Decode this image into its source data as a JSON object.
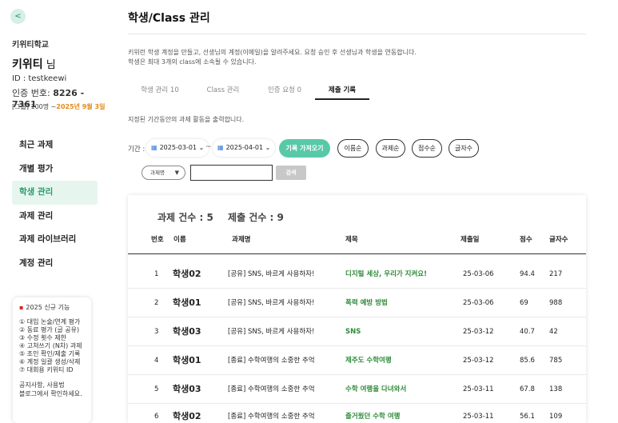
{
  "sidebar": {
    "collapse_symbol": "<",
    "school": "키위티학교",
    "user_name": "키위티",
    "user_suffix": " 님",
    "user_id": "ID : testkeewi",
    "auth_label": "인증 번호: ",
    "auth_code": "8226 - 7361",
    "group_prefix": "[그룹] 100명 ~",
    "group_date": "2025년 9월 3일",
    "nav": [
      {
        "label": "최근 과제",
        "active": false
      },
      {
        "label": "개별 평가",
        "active": false
      },
      {
        "label": "학생 관리",
        "active": true
      },
      {
        "label": "과제 관리",
        "active": false
      },
      {
        "label": "과제 라이브러리",
        "active": false
      },
      {
        "label": "계정 관리",
        "active": false
      }
    ],
    "notice": {
      "title": "2025 신규 기능",
      "flag_icon": "flag-icon",
      "features": [
        "① 대입 논술/연계 평가",
        "② 동료 평가 (글 공유)",
        "③ 수정 횟수 제한",
        "④ 고쳐쓰기 (N차) 과제",
        "⑤ 조인 확인/제출 기록",
        "⑥ 계정 일괄 생성/삭제",
        "⑦ 대회용 키위티 ID"
      ],
      "footer_line1": "공지사항, 사용법",
      "footer_line2": "블로그에서 확인하세요."
    }
  },
  "main": {
    "title": "학생/Class 관리",
    "desc_line1": "키위런 학생 계정을 만들고, 선생님의 계정(이메일)을 알려주세요. 요청 승인 후 선생님과 학생을 연동합니다.",
    "desc_line2": "학생은 최대 3개의 class에 소속될 수 있습니다.",
    "tabs": [
      {
        "label": "학생 관리  10",
        "active": false
      },
      {
        "label": "Class 관리",
        "active": false
      },
      {
        "label": "인증 요청  0",
        "active": false
      },
      {
        "label": "제출 기록",
        "active": true
      }
    ],
    "period_note": "지정된 기간동안의 과제 활동을 출력합니다.",
    "filter_label": "기간 :",
    "start_date": "2025-03-01",
    "end_date": "2025-04-01",
    "tilde": "~",
    "fetch_label": "기록 가져오기",
    "sort_buttons": [
      "이름순",
      "과제순",
      "점수순",
      "글자수"
    ],
    "search_select": "과제명",
    "search_value": "",
    "search_button": "검색",
    "count_task": "과제 건수 : 5",
    "count_submit": "제출 건수 : 9",
    "table": {
      "headers": [
        "번호",
        "이름",
        "과제명",
        "제목",
        "제출일",
        "점수",
        "글자수"
      ],
      "rows": [
        {
          "no": "1",
          "name": "학생02",
          "task": "[공유] SNS, 바르게 사용하자!",
          "title": "디지털 세상, 우리가 지켜요!",
          "date": "25-03-06",
          "score": "94.4",
          "chars": "217"
        },
        {
          "no": "2",
          "name": "학생01",
          "task": "[공유] SNS, 바르게 사용하자!",
          "title": "폭력 예방 방법",
          "date": "25-03-06",
          "score": "69",
          "chars": "988"
        },
        {
          "no": "3",
          "name": "학생03",
          "task": "[공유] SNS, 바르게 사용하자!",
          "title": "SNS",
          "date": "25-03-12",
          "score": "40.7",
          "chars": "42"
        },
        {
          "no": "4",
          "name": "학생01",
          "task": "[종료] 수학여행의 소중한 추억",
          "title": "제주도 수학여행",
          "date": "25-03-12",
          "score": "85.6",
          "chars": "785"
        },
        {
          "no": "5",
          "name": "학생03",
          "task": "[종료] 수학여행의 소중한 추억",
          "title": "수학 여행을 다녀와서",
          "date": "25-03-11",
          "score": "67.8",
          "chars": "138"
        },
        {
          "no": "6",
          "name": "학생02",
          "task": "[종료] 수학여행의 소중한 추억",
          "title": "즐거웠던 수학 여행",
          "date": "25-03-11",
          "score": "56.1",
          "chars": "109"
        }
      ]
    }
  },
  "colors": {
    "accent": "#58c9a8",
    "nav_active_bg": "#e6f6ef",
    "nav_active_text": "#2a9a6f",
    "title_green": "#2f8a3a",
    "date_orange": "#e48a17"
  }
}
